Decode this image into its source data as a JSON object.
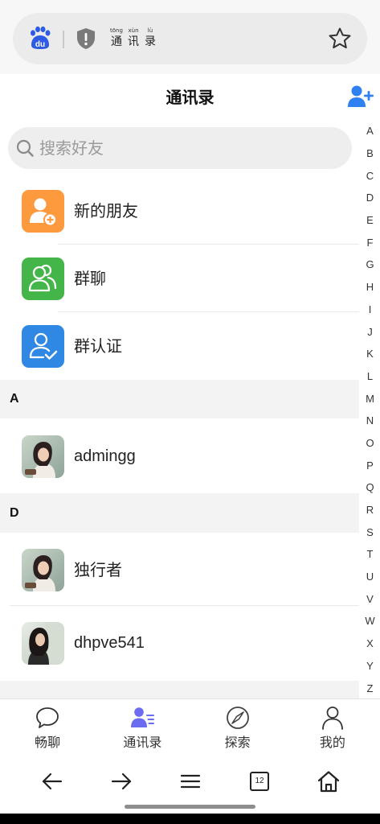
{
  "browser_bar": {
    "logo_text": "du",
    "page_title_pinyin": [
      "tōng",
      "xùn",
      "lù"
    ],
    "page_title_chars": [
      "通",
      "讯",
      "录"
    ],
    "icons": {
      "logo": "baidu-paw-icon",
      "security": "shield-alert-icon",
      "bookmark": "star-icon"
    }
  },
  "header": {
    "title": "通讯录",
    "action_icon": "add-user-icon"
  },
  "search": {
    "placeholder": "搜索好友",
    "icon": "search-icon"
  },
  "quick_entries": [
    {
      "label": "新的朋友",
      "icon": "new-friend-icon",
      "color": "#fd9a3e"
    },
    {
      "label": "群聊",
      "icon": "group-chat-icon",
      "color": "#44b549"
    },
    {
      "label": "群认证",
      "icon": "group-verify-icon",
      "color": "#2f88e3"
    }
  ],
  "sections": [
    {
      "letter": "A",
      "contacts": [
        {
          "name": "admingg"
        }
      ]
    },
    {
      "letter": "D",
      "contacts": [
        {
          "name": "独行者"
        },
        {
          "name": "dhpve541"
        }
      ]
    }
  ],
  "index_letters": [
    "A",
    "B",
    "C",
    "D",
    "E",
    "F",
    "G",
    "H",
    "I",
    "J",
    "K",
    "L",
    "M",
    "N",
    "O",
    "P",
    "Q",
    "R",
    "S",
    "T",
    "U",
    "V",
    "W",
    "X",
    "Y",
    "Z"
  ],
  "tabbar": {
    "items": [
      {
        "label": "畅聊",
        "icon": "chat-bubble-icon",
        "active": false
      },
      {
        "label": "通讯录",
        "icon": "contacts-icon",
        "active": true
      },
      {
        "label": "探索",
        "icon": "compass-icon",
        "active": false
      },
      {
        "label": "我的",
        "icon": "profile-icon",
        "active": false
      }
    ]
  },
  "browser_nav": {
    "tab_count": "12",
    "icons": [
      "back-arrow-icon",
      "forward-arrow-icon",
      "menu-icon",
      "tabs-icon",
      "home-icon"
    ]
  },
  "colors": {
    "accent": "#2f80f0",
    "active_tab": "#6c6cf0",
    "section_bg": "#f3f3f3",
    "search_bg": "#eeeeee"
  }
}
